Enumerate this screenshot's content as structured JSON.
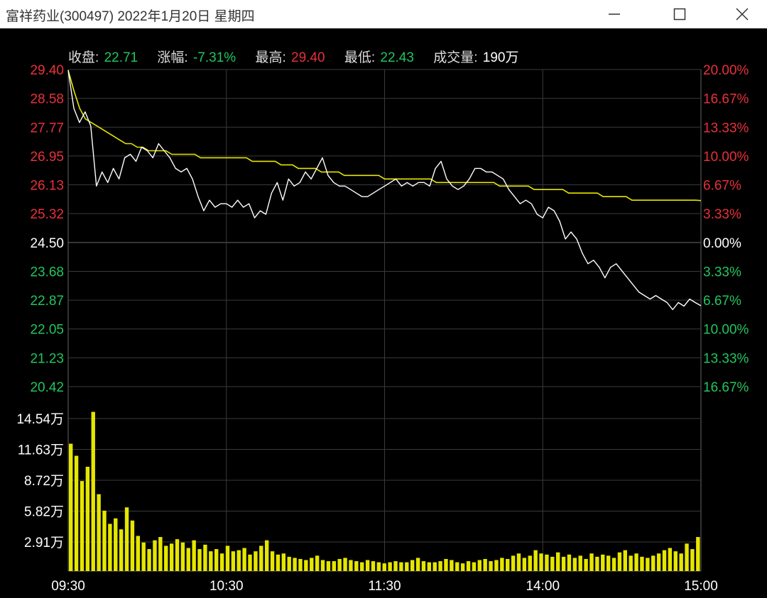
{
  "window": {
    "title": "富祥药业(300497)  2022年1月20日  星期四"
  },
  "info": {
    "close_label": "收盘:",
    "close_value": "22.71",
    "change_label": "涨幅:",
    "change_value": "-7.31%",
    "high_label": "最高:",
    "high_value": "29.40",
    "low_label": "最低:",
    "low_value": "22.43",
    "volume_label": "成交量:",
    "volume_value": "190万"
  },
  "colors": {
    "up": "#e8303a",
    "down": "#22c55e",
    "neutral": "#ffffff",
    "price_line": "#ffffff",
    "avg_line": "#e6e600",
    "volume_bar": "#e6e600",
    "grid": "#3a3a3a"
  },
  "chart_data": {
    "type": "line",
    "prev_close": 24.5,
    "price_axis": {
      "ticks": [
        "29.40",
        "28.58",
        "27.77",
        "26.95",
        "26.13",
        "25.32",
        "24.50",
        "23.68",
        "22.87",
        "22.05",
        "21.23",
        "20.42"
      ],
      "ylim": [
        20.42,
        29.4
      ]
    },
    "pct_axis": {
      "ticks": [
        "20.00%",
        "16.67%",
        "13.33%",
        "10.00%",
        "6.67%",
        "3.33%",
        "0.00%",
        "3.33%",
        "6.67%",
        "10.00%",
        "13.33%",
        "16.67%"
      ]
    },
    "volume_axis": {
      "ticks": [
        "14.54万",
        "11.63万",
        "8.72万",
        "5.82万",
        "2.91万"
      ],
      "ylim": [
        0,
        14.54
      ]
    },
    "time_axis": [
      "09:30",
      "10:30",
      "11:30",
      "14:00",
      "15:00"
    ],
    "price": [
      29.38,
      28.3,
      27.9,
      28.2,
      27.8,
      26.1,
      26.5,
      26.2,
      26.6,
      26.3,
      26.9,
      27.0,
      26.8,
      27.2,
      27.1,
      26.9,
      27.3,
      27.1,
      26.9,
      26.6,
      26.5,
      26.6,
      26.3,
      25.8,
      25.4,
      25.7,
      25.5,
      25.6,
      25.6,
      25.5,
      25.7,
      25.5,
      25.6,
      25.2,
      25.4,
      25.3,
      25.9,
      26.2,
      25.7,
      26.3,
      26.1,
      26.2,
      26.5,
      26.3,
      26.6,
      26.9,
      26.4,
      26.2,
      26.1,
      26.1,
      26.0,
      25.9,
      25.8,
      25.8,
      25.9,
      26.0,
      26.1,
      26.2,
      26.3,
      26.1,
      26.2,
      26.1,
      26.2,
      26.2,
      26.1,
      26.6,
      26.8,
      26.3,
      26.1,
      26.0,
      26.1,
      26.3,
      26.6,
      26.6,
      26.5,
      26.5,
      26.4,
      26.3,
      26.0,
      25.8,
      25.6,
      25.7,
      25.6,
      25.3,
      25.2,
      25.5,
      25.4,
      25.1,
      24.6,
      24.8,
      24.6,
      24.2,
      23.9,
      24.0,
      23.8,
      23.5,
      23.8,
      23.9,
      23.7,
      23.5,
      23.3,
      23.1,
      23.0,
      22.9,
      23.0,
      22.9,
      22.8,
      22.6,
      22.8,
      22.7,
      22.9,
      22.8,
      22.71
    ],
    "avg_price": [
      29.38,
      28.8,
      28.3,
      28.0,
      27.9,
      27.8,
      27.7,
      27.6,
      27.5,
      27.4,
      27.3,
      27.3,
      27.2,
      27.2,
      27.1,
      27.1,
      27.1,
      27.1,
      27.0,
      27.0,
      27.0,
      27.0,
      27.0,
      26.9,
      26.9,
      26.9,
      26.9,
      26.9,
      26.9,
      26.9,
      26.9,
      26.9,
      26.8,
      26.8,
      26.8,
      26.8,
      26.8,
      26.7,
      26.7,
      26.7,
      26.6,
      26.6,
      26.6,
      26.6,
      26.5,
      26.5,
      26.5,
      26.5,
      26.4,
      26.4,
      26.4,
      26.4,
      26.4,
      26.4,
      26.4,
      26.3,
      26.3,
      26.3,
      26.3,
      26.3,
      26.3,
      26.3,
      26.3,
      26.3,
      26.2,
      26.2,
      26.2,
      26.2,
      26.2,
      26.2,
      26.2,
      26.2,
      26.2,
      26.2,
      26.2,
      26.1,
      26.1,
      26.1,
      26.1,
      26.1,
      26.1,
      26.0,
      26.0,
      26.0,
      26.0,
      26.0,
      26.0,
      25.9,
      25.9,
      25.9,
      25.9,
      25.9,
      25.9,
      25.8,
      25.8,
      25.8,
      25.8,
      25.8,
      25.7,
      25.7,
      25.7,
      25.7,
      25.7,
      25.7,
      25.7,
      25.7,
      25.7,
      25.7,
      25.7,
      25.7,
      25.69
    ],
    "volume": [
      11.6,
      10.5,
      8.2,
      9.5,
      14.5,
      7.0,
      5.5,
      4.3,
      4.8,
      3.8,
      5.8,
      4.6,
      3.2,
      2.6,
      2.0,
      2.8,
      3.1,
      2.3,
      2.5,
      2.9,
      2.6,
      2.1,
      2.8,
      2.0,
      2.4,
      1.8,
      2.0,
      1.6,
      2.3,
      1.8,
      1.9,
      2.1,
      1.5,
      1.8,
      2.3,
      2.8,
      1.8,
      1.5,
      1.6,
      1.3,
      1.2,
      1.1,
      1.0,
      1.2,
      1.4,
      1.0,
      0.9,
      0.9,
      1.1,
      1.2,
      1.0,
      0.9,
      0.8,
      1.0,
      0.9,
      0.8,
      0.7,
      0.8,
      0.9,
      0.8,
      0.8,
      1.0,
      1.2,
      0.9,
      0.8,
      0.8,
      0.9,
      1.1,
      1.0,
      0.8,
      0.7,
      0.9,
      0.8,
      1.0,
      1.1,
      0.9,
      1.0,
      1.2,
      1.1,
      1.4,
      1.6,
      1.2,
      1.4,
      1.9,
      1.6,
      1.5,
      1.3,
      1.7,
      1.3,
      1.5,
      1.2,
      1.4,
      1.1,
      1.6,
      1.3,
      1.5,
      1.4,
      1.2,
      1.7,
      1.9,
      1.4,
      1.6,
      1.3,
      1.2,
      1.4,
      1.6,
      1.9,
      2.1,
      1.8,
      1.6,
      2.5,
      2.0,
      3.1
    ]
  }
}
